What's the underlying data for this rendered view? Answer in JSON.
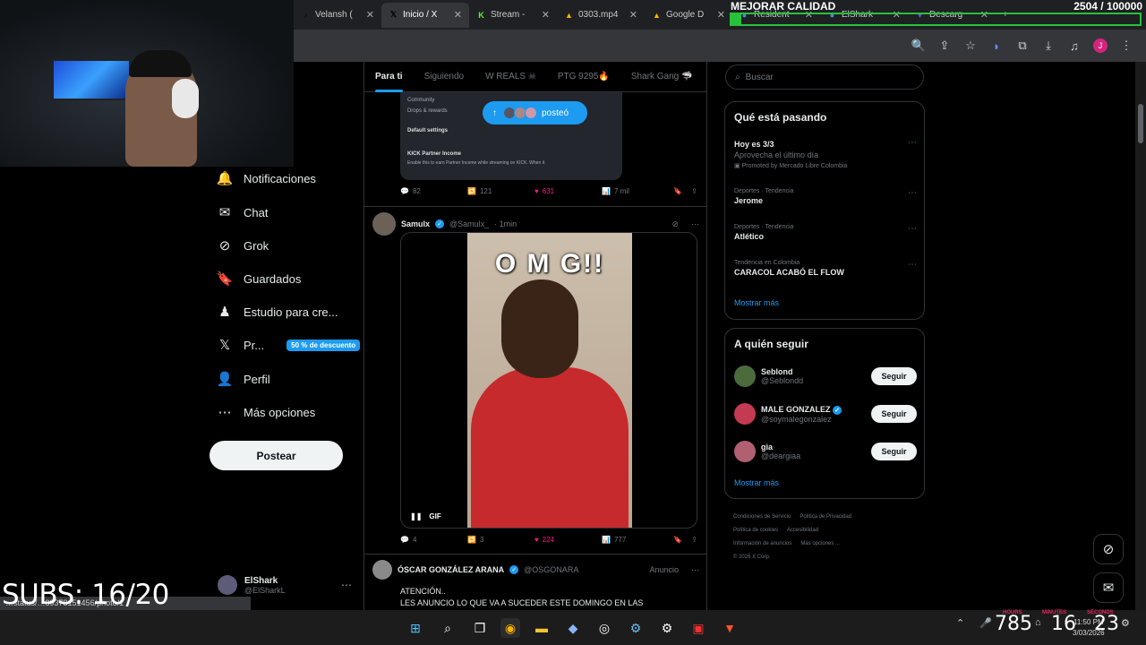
{
  "browser": {
    "tabs": [
      {
        "label": "Velansh (",
        "icon": "tiktok-icon",
        "color": "#000000",
        "glyph": "♪",
        "active": false
      },
      {
        "label": "Inicio / X",
        "icon": "x-logo-icon",
        "color": "#000000",
        "glyph": "𝕏",
        "active": true
      },
      {
        "label": "Stream - ",
        "icon": "kick-icon",
        "color": "#53fc18",
        "glyph": "K",
        "active": false
      },
      {
        "label": "0303.mp4",
        "icon": "drive-icon",
        "color": "#f4b400",
        "glyph": "▲",
        "active": false
      },
      {
        "label": "Google D",
        "icon": "drive-icon",
        "color": "#f4b400",
        "glyph": "▲",
        "active": false
      },
      {
        "label": "Resident",
        "icon": "app-icon",
        "color": "#3c8fe0",
        "glyph": "●",
        "active": false
      },
      {
        "label": "ElShark",
        "icon": "app-icon",
        "color": "#3c8fe0",
        "glyph": "●",
        "active": false
      },
      {
        "label": "Descarg",
        "icon": "download-app-icon",
        "color": "#5a5ad8",
        "glyph": "▼",
        "active": false
      }
    ]
  },
  "overlay": {
    "mejorar": "MEJORAR CALIDAD",
    "goal_text": "2504 / 100000",
    "goal_progress": 0.025,
    "subs": "SUBS: 16/20",
    "url_hint": "…status/…39378151456/photo/1",
    "timer_labels": [
      "HOURS",
      "MINUTES",
      "SECONDS"
    ],
    "timer": [
      "16",
      "23"
    ],
    "counter": "785"
  },
  "nav": {
    "items": [
      {
        "label": "Notificaciones",
        "icon": "bell-icon",
        "glyph": "🔔"
      },
      {
        "label": "Chat",
        "icon": "mail-icon",
        "glyph": "✉"
      },
      {
        "label": "Grok",
        "icon": "grok-icon",
        "glyph": "⊘"
      },
      {
        "label": "Guardados",
        "icon": "bookmark-icon",
        "glyph": "🔖"
      },
      {
        "label": "Estudio para cre...",
        "icon": "studio-icon",
        "glyph": "♟"
      },
      {
        "label": "Pr...",
        "icon": "x-logo-icon",
        "glyph": "𝕏"
      },
      {
        "label": "Perfil",
        "icon": "person-icon",
        "glyph": "👤"
      },
      {
        "label": "Más opciones",
        "icon": "more-circle-icon",
        "glyph": "⋯"
      }
    ],
    "premium_badge": "50 % de descuento",
    "post_button": "Postear",
    "account_name": "ElShark",
    "account_handle": "@ElSharkL"
  },
  "timeline": {
    "tabs": [
      "Para ti",
      "Siguiendo",
      "W REALS ☠",
      "PTG 9295🔥",
      "Shark Gang 🦈"
    ],
    "posted_pill": "posteó",
    "post1_image_rows": [
      "Community",
      "Drops & rewards",
      "Default settings",
      "KICK Partner Income",
      "Enable this to earn Partner Income while streaming on KICK. When it"
    ],
    "post1_actions": {
      "replies": "82",
      "reposts": "121",
      "likes": "631",
      "views": "7 mil"
    },
    "post2": {
      "name": "Samulx",
      "handle": "@Samulx_",
      "time": "· 1min",
      "gif_text": "O M G!!",
      "gif_label": "GIF",
      "replies": "4",
      "reposts": "3",
      "likes": "224",
      "views": "777"
    },
    "ad": {
      "name": "ÓSCAR GONZÁLEZ ARANA",
      "handle": "@OSGONARA",
      "tag": "Anuncio",
      "text": "ATENCIÓN..\nLES ANUNCIO LO QUE VA A SUCEDER ESTE DOMINGO EN LAS ELECCIONES."
    }
  },
  "sidebar": {
    "search_placeholder": "Buscar",
    "trending_title": "Qué está pasando",
    "trends": [
      {
        "category": "",
        "title": "Hoy es 3/3",
        "sub": "Aprovecha el último día",
        "promo": "Promoted by Mercado Libre Colombia"
      },
      {
        "category": "Deportes · Tendencia",
        "title": "Jerome",
        "sub": "",
        "promo": ""
      },
      {
        "category": "Deportes · Tendencia",
        "title": "Atlético",
        "sub": "",
        "promo": ""
      },
      {
        "category": "Tendencia en Colombia",
        "title": "CARACOL ACABÓ EL FLOW",
        "sub": "",
        "promo": ""
      }
    ],
    "show_more": "Mostrar más",
    "follow_title": "A quién seguir",
    "follow": [
      {
        "name": "Seblond",
        "handle": "@Seblondd",
        "color": "#4c6b3c"
      },
      {
        "name": "MALE GONZALEZ",
        "handle": "@soymalegonzalez",
        "color": "#c43a52"
      },
      {
        "name": "gia",
        "handle": "@deargiaa",
        "color": "#b06070"
      }
    ],
    "follow_button": "Seguir",
    "footer": [
      "Condiciones de Servicio",
      "Política de Privacidad",
      "Política de cookies",
      "Accesibilidad",
      "Información de anuncios",
      "Más opciones ...",
      "© 2026 X Corp."
    ]
  },
  "taskbar": {
    "clock_time": "11:50 PM",
    "clock_date": "3/03/2026"
  }
}
